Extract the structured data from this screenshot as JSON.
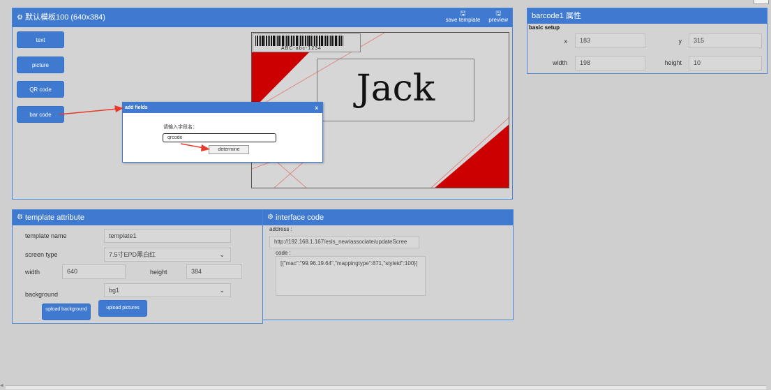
{
  "editor": {
    "title": "默认模板100 (640x384)",
    "save_template": "save template",
    "preview": "preview",
    "side_buttons": [
      "text",
      "picture",
      "QR code",
      "bar code"
    ],
    "barcode_text": "ABC-abc-1234",
    "jack_text": "Jack"
  },
  "dialog": {
    "title": "add fields",
    "close": "x",
    "label": "请输入字段名：",
    "input_value": "qrcode",
    "button": "determine"
  },
  "attributes": {
    "title": "barcode1 属性",
    "section": "basic setup",
    "x_label": "x",
    "x_value": "183",
    "y_label": "y",
    "y_value": "315",
    "width_label": "width",
    "width_value": "198",
    "height_label": "height",
    "height_value": "10"
  },
  "template": {
    "title": "template attribute",
    "name_label": "template name",
    "name_value": "template1",
    "screen_label": "screen type",
    "screen_value": "7.5寸EPD黑白红",
    "width_label": "width",
    "width_value": "640",
    "height_label": "height",
    "height_value": "384",
    "bg_label": "background",
    "bg_value": "bg1",
    "upload_bg": "upload background",
    "upload_pics": "upload pictures"
  },
  "interface": {
    "title": "interface code",
    "address_label": "address :",
    "address_value": "http://192.168.1.167/esls_new/associate/updateScree",
    "code_label": "code :",
    "code_value": "[{\"mac\":\"99.96.19.64\",\"mappingtype\":871,\"styleid\":100}]"
  },
  "colors": {
    "accent": "#3f7ad0",
    "red": "#cc0000",
    "arrow": "#e8392b"
  },
  "icons": [
    "gear-icon",
    "save-icon",
    "preview-icon",
    "chevron-down-icon",
    "close-icon"
  ]
}
